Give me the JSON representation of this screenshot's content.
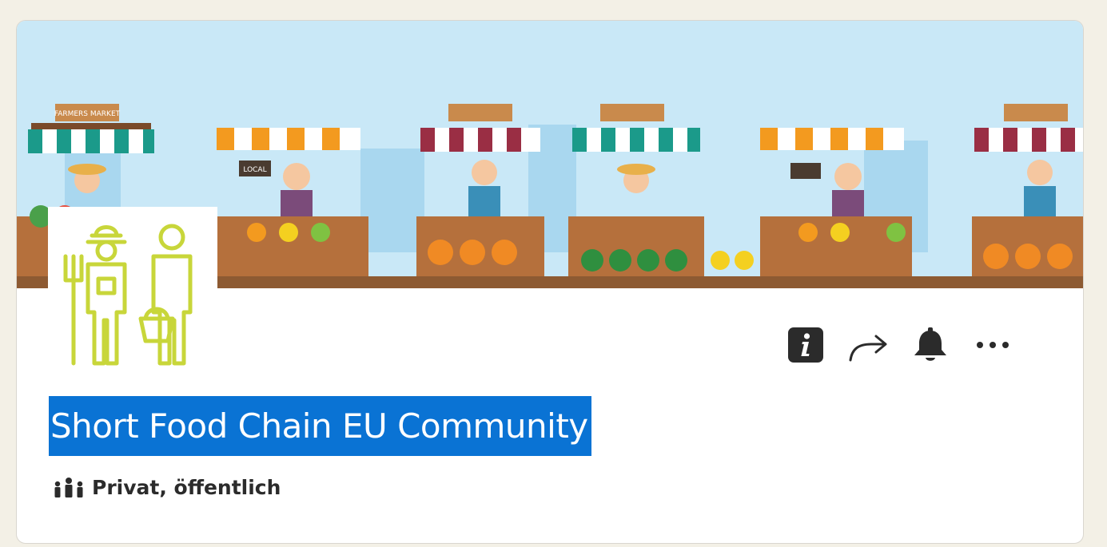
{
  "group": {
    "title": "Short Food Chain EU Community",
    "privacy": "Privat, öffentlich",
    "logo_icon": "farmer-and-shopper-icon"
  },
  "banner": {
    "sign_text": "FARMERS MARKET",
    "board_text": "LOCAL"
  },
  "actions": [
    {
      "name": "info",
      "icon": "info-icon"
    },
    {
      "name": "share",
      "icon": "share-arrow-icon"
    },
    {
      "name": "notifications",
      "icon": "bell-icon"
    },
    {
      "name": "more",
      "icon": "more-icon"
    }
  ],
  "colors": {
    "title_highlight": "#0a73d4",
    "logo_color": "#c8d63a",
    "sky": "#bfe3f5",
    "page_background": "#f3f0e6"
  }
}
